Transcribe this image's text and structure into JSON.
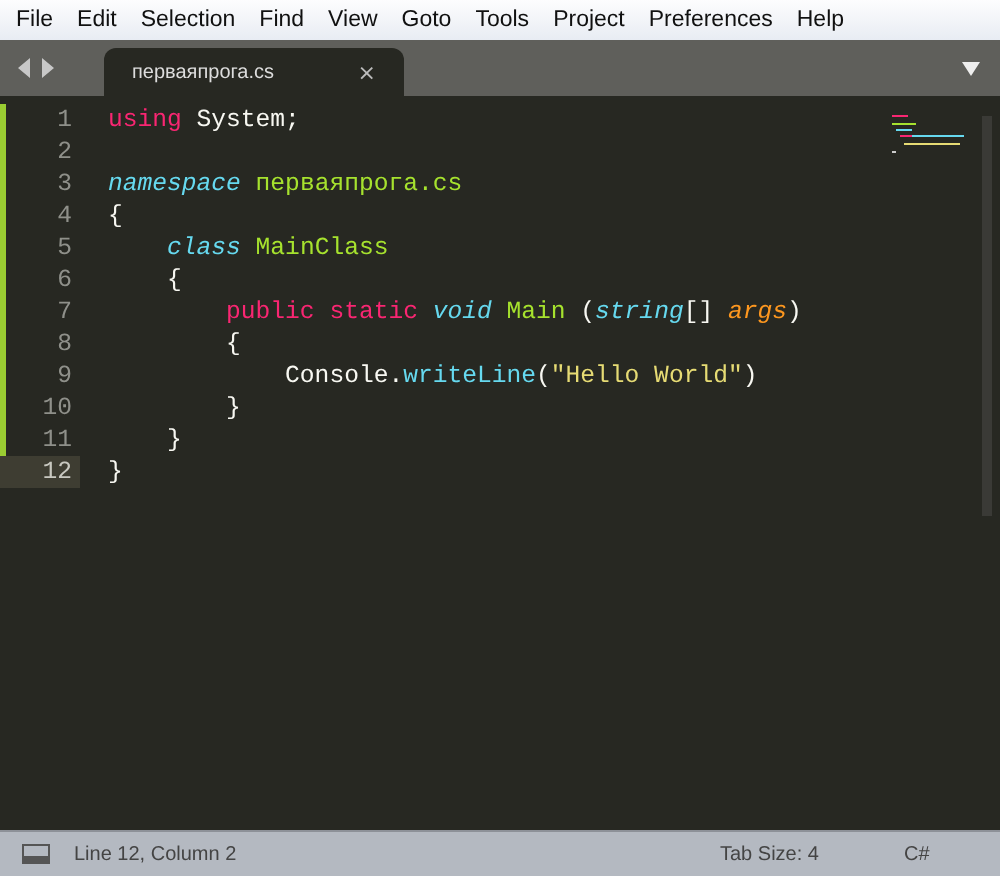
{
  "menu": [
    "File",
    "Edit",
    "Selection",
    "Find",
    "View",
    "Goto",
    "Tools",
    "Project",
    "Preferences",
    "Help"
  ],
  "tabs": [
    {
      "label": "перваяпрога.cs",
      "close": "×",
      "selected": true
    }
  ],
  "lines": [
    {
      "number": "1",
      "modified": true,
      "current": false,
      "tokens": [
        {
          "kind": "keyword",
          "text": "using"
        },
        {
          "kind": "plain",
          "text": " System;"
        }
      ]
    },
    {
      "number": "2",
      "modified": true,
      "current": false
    },
    {
      "number": "3",
      "modified": true,
      "current": false,
      "tokens": [
        {
          "kind": "storage",
          "text": "namespace"
        },
        {
          "kind": "entity",
          "text": " перваяпрога.cs"
        }
      ]
    },
    {
      "number": "4",
      "modified": true,
      "current": false,
      "tokens": [
        {
          "kind": "plain",
          "text": "{"
        }
      ]
    },
    {
      "number": "5",
      "modified": true,
      "current": false,
      "tokens": [
        {
          "kind": "storage",
          "text": "    class"
        },
        {
          "kind": "entity",
          "text": " MainClass"
        }
      ]
    },
    {
      "number": "6",
      "modified": true,
      "current": false,
      "tokens": [
        {
          "kind": "plain",
          "text": "    {"
        }
      ]
    },
    {
      "number": "7",
      "modified": true,
      "current": false,
      "tokens": [
        {
          "kind": "keyword",
          "text": "        public static"
        },
        {
          "kind": "storage",
          "text": " void"
        },
        {
          "kind": "entity",
          "text": " Main"
        },
        {
          "kind": "plain",
          "text": " ("
        },
        {
          "kind": "storage",
          "text": "string"
        },
        {
          "kind": "plain",
          "text": "[] "
        },
        {
          "kind": "param",
          "text": "args"
        },
        {
          "kind": "plain",
          "text": ")"
        }
      ]
    },
    {
      "number": "8",
      "modified": true,
      "current": false,
      "tokens": [
        {
          "kind": "plain",
          "text": "        {"
        }
      ]
    },
    {
      "number": "9",
      "modified": true,
      "current": false,
      "tokens": [
        {
          "kind": "plain",
          "text": "            Console."
        },
        {
          "kind": "function",
          "text": "writeLine"
        },
        {
          "kind": "plain",
          "text": "("
        },
        {
          "kind": "string",
          "text": "\"Hello World\""
        },
        {
          "kind": "plain",
          "text": ")"
        }
      ]
    },
    {
      "number": "10",
      "modified": true,
      "current": false,
      "tokens": [
        {
          "kind": "plain",
          "text": "        }"
        }
      ]
    },
    {
      "number": "11",
      "modified": true,
      "current": false,
      "tokens": [
        {
          "kind": "plain",
          "text": "    }"
        }
      ]
    },
    {
      "number": "12",
      "modified": false,
      "current": true,
      "tokens": [
        {
          "kind": "plain",
          "text": "}"
        }
      ]
    }
  ],
  "status_bar": {
    "position": "Line 12, Column 2",
    "tab_size": "Tab Size: 4",
    "syntax": "C#"
  }
}
